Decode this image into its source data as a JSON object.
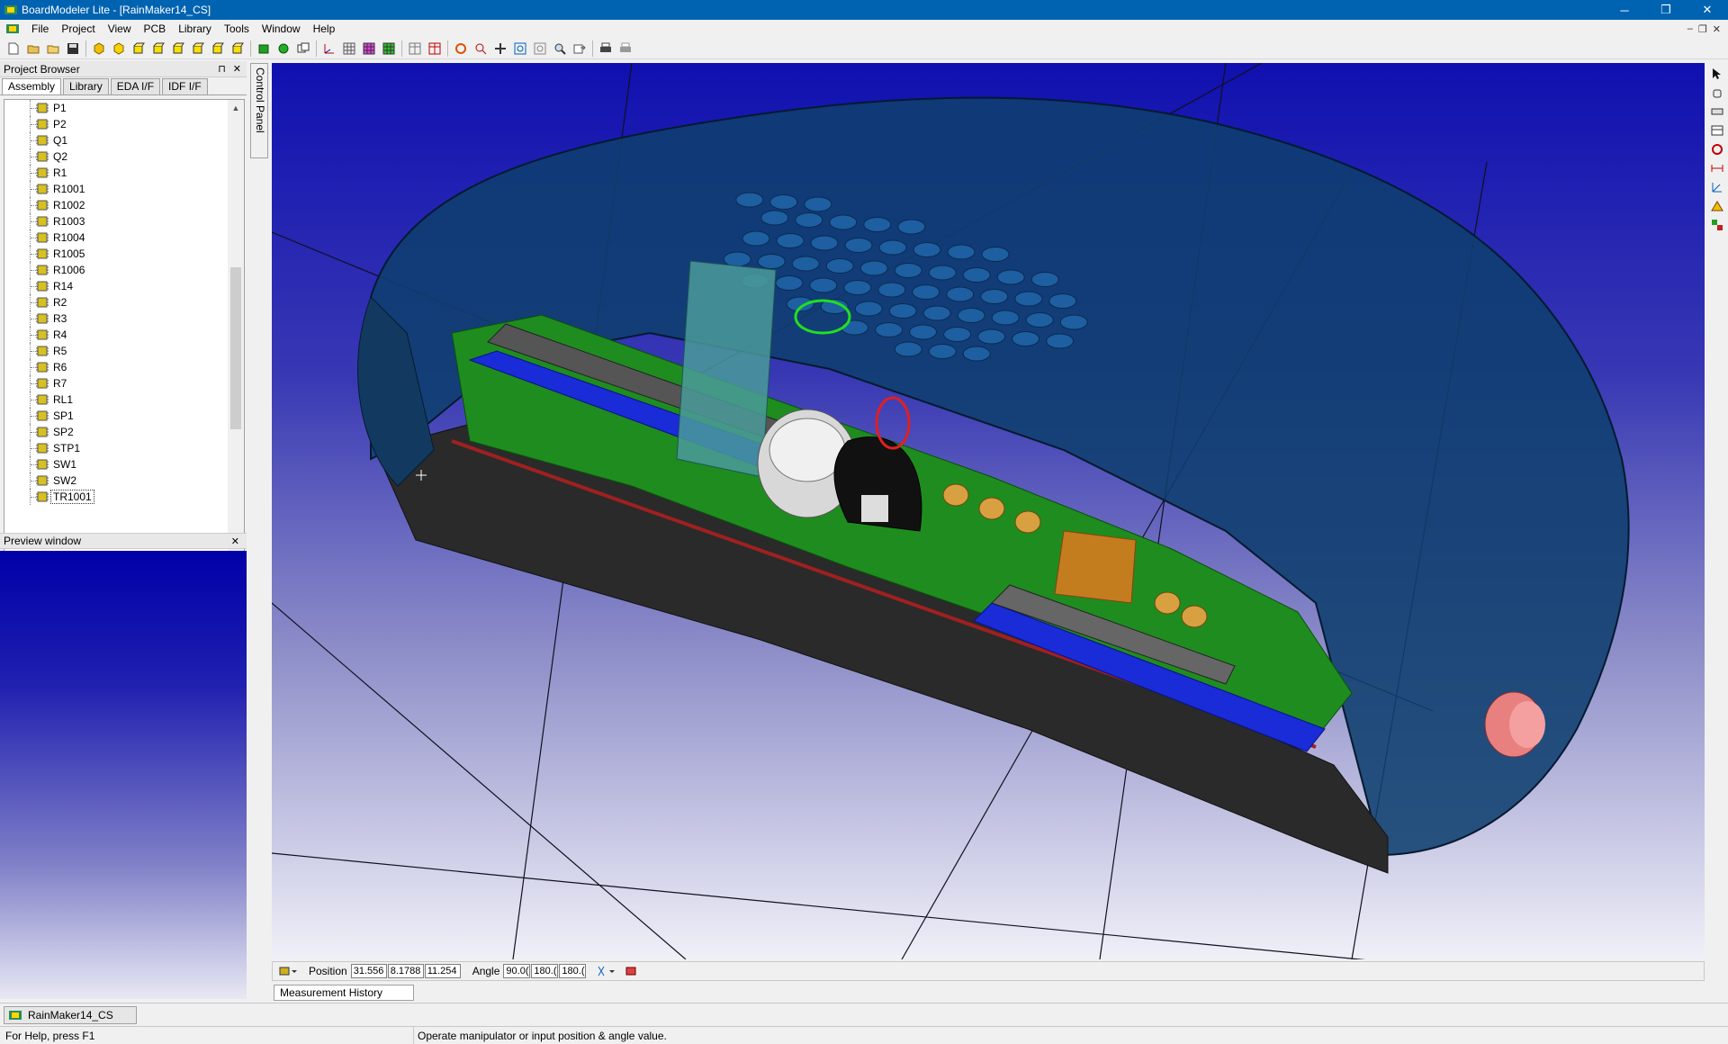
{
  "window": {
    "title": "BoardModeler Lite - [RainMaker14_CS]",
    "minimize": "─",
    "restore": "❐",
    "close": "✕"
  },
  "menu": {
    "items": [
      "File",
      "Project",
      "View",
      "PCB",
      "Library",
      "Tools",
      "Window",
      "Help"
    ],
    "mdi_min": "–",
    "mdi_restore": "❐",
    "mdi_close": "✕"
  },
  "project_browser": {
    "title": "Project Browser",
    "pin": "⊓",
    "close": "✕",
    "tabs": [
      "Assembly",
      "Library",
      "EDA I/F",
      "IDF I/F"
    ],
    "active_tab": "Assembly",
    "tree_items": [
      "P1",
      "P2",
      "Q1",
      "Q2",
      "R1",
      "R1001",
      "R1002",
      "R1003",
      "R1004",
      "R1005",
      "R1006",
      "R14",
      "R2",
      "R3",
      "R4",
      "R5",
      "R6",
      "R7",
      "RL1",
      "SP1",
      "SP2",
      "STP1",
      "SW1",
      "SW2",
      "TR1001"
    ],
    "selected_item": "TR1001"
  },
  "preview": {
    "title": "Preview window",
    "close": "✕"
  },
  "control_panel": {
    "label": "Control Panel"
  },
  "position_bar": {
    "position_label": "Position",
    "pos_x": "31.556",
    "pos_y": "8.1788",
    "pos_z": "11.254",
    "angle_label": "Angle",
    "ang_x": "90.0(",
    "ang_y": "180.(",
    "ang_z": "180.("
  },
  "measurement_panel": {
    "label": "Measurement History Panel"
  },
  "window_list": {
    "doc": "RainMaker14_CS"
  },
  "status": {
    "help": "For Help, press F1",
    "message": "Operate manipulator or input position & angle value."
  },
  "colors": {
    "titlebar": "#0063b1",
    "pcb_green": "#1f8c1f",
    "enclosure": "#0f3f6e",
    "slider_blue": "#1a2bd8"
  }
}
